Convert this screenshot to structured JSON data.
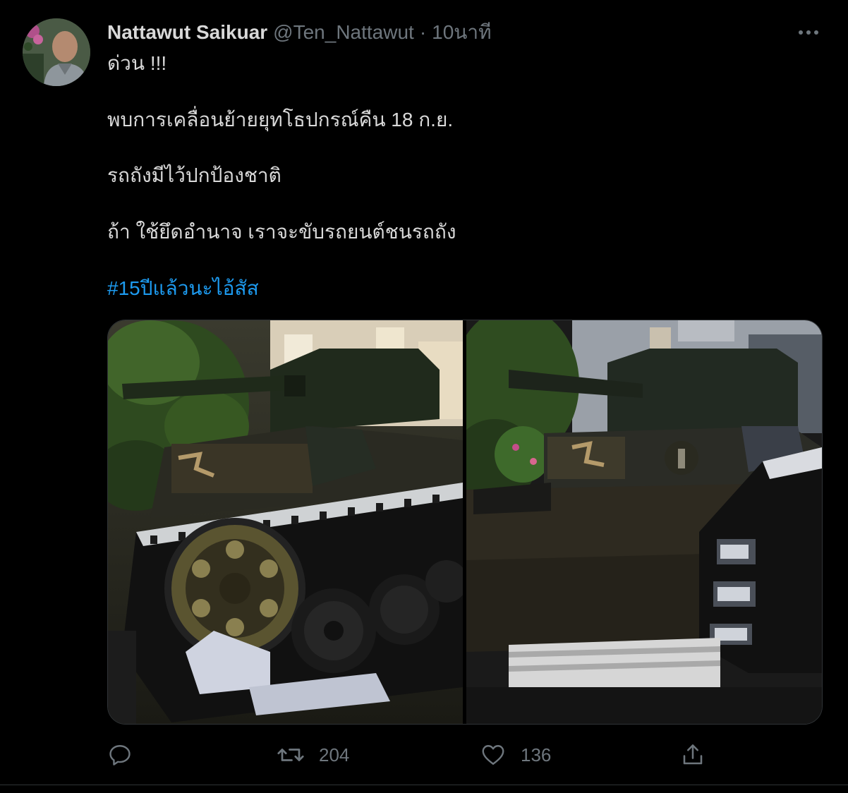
{
  "tweet": {
    "display_name": "Nattawut Saikuar",
    "handle": "@Ten_Nattawut",
    "separator": "·",
    "time": "10นาที",
    "more_icon": "more-horizontal-icon",
    "lines": [
      "ด่วน !!!",
      "พบการเคลื่อนย้ายยุทโธปกรณ์คืน 18 ก.ย.",
      "รถถังมีไว้ปกป้องชาติ",
      "ถ้า ใช้ยึดอำนาจ เราจะขับรถยนต์ชนรถถัง"
    ],
    "hashtag": "#15ปีแล้วนะไอ้สัส",
    "hashtag_color": "#1d9bf0",
    "media": {
      "photos": [
        "tank-photo-front",
        "tank-photo-side"
      ]
    },
    "actions": {
      "reply": {
        "icon": "reply-icon",
        "count": ""
      },
      "retweet": {
        "icon": "retweet-icon",
        "count": "204"
      },
      "like": {
        "icon": "heart-icon",
        "count": "136"
      },
      "share": {
        "icon": "share-icon"
      }
    }
  },
  "colors": {
    "background": "#000000",
    "text": "#d9d9d9",
    "muted": "#6e767d",
    "link": "#1d9bf0",
    "border": "#2f3336"
  }
}
